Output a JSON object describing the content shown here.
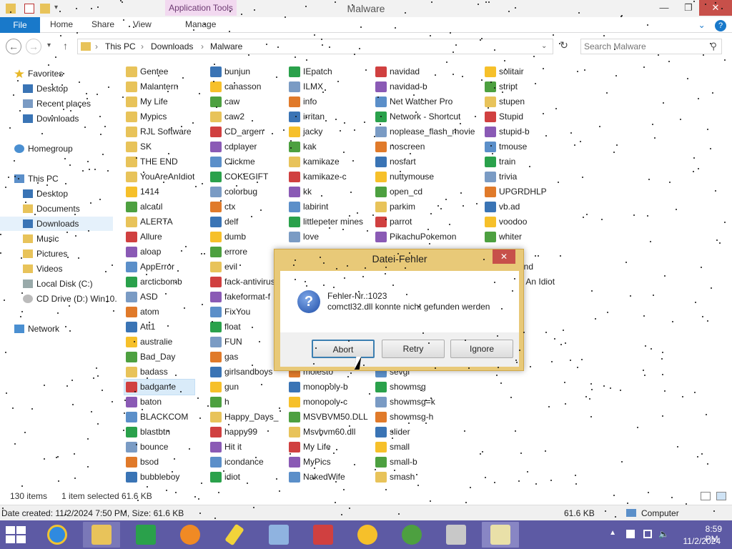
{
  "window": {
    "title": "Malware",
    "context_tab": "Application Tools",
    "minimize": "—",
    "maximize": "❐",
    "close": "✕"
  },
  "ribbon": {
    "file": "File",
    "home": "Home",
    "share": "Share",
    "view": "View",
    "manage": "Manage",
    "help": "?"
  },
  "address": {
    "back": "←",
    "forward": "→",
    "up": "↑",
    "crumbs": [
      "This PC",
      "Downloads",
      "Malware"
    ],
    "refresh": "↻",
    "search_placeholder": "Search Malware"
  },
  "nav": {
    "favorites": "Favorites",
    "desktop1": "Desktop",
    "recent": "Recent places",
    "downloads1": "Downloads",
    "homegroup": "Homegroup",
    "thispc": "This PC",
    "desktop2": "Desktop",
    "documents": "Documents",
    "downloads2": "Downloads",
    "music": "Music",
    "pictures": "Pictures",
    "videos": "Videos",
    "localdisk": "Local Disk (C:)",
    "cddrive": "CD Drive (D:) Win10.",
    "network": "Network"
  },
  "files": {
    "col1": [
      "Gentee",
      "Malantern",
      "My Life",
      "Mypics",
      "RJL Software",
      "SK",
      "THE END",
      "YouAreAnIdiot",
      "1414",
      "alcaul",
      "ALERTA",
      "Allure",
      "aloap",
      "AppError",
      "arcticbomb",
      "ASD",
      "atom",
      "Att1",
      "australie",
      "Bad_Day",
      "badass",
      "badgame",
      "baton",
      "BLACKCOM",
      "blastbtn",
      "bounce",
      "bsod",
      "bubbleboy"
    ],
    "col2": [
      "bunjun",
      "canasson",
      "caw",
      "caw2",
      "CD_argen",
      "cdplayer",
      "Clickme",
      "COKEGIFT",
      "colorbug",
      "ctx",
      "delf",
      "dumb",
      "errore",
      "evil",
      "fack-antivirus",
      "fakeformat-f",
      "FixYou",
      "float",
      "FUN",
      "gas",
      "girlsandboys",
      "gun",
      "h",
      "Happy_Days_",
      "happy99",
      "Hit it",
      "icondance",
      "idiot"
    ],
    "col3": [
      "IEpatch",
      "ILMX",
      "info",
      "irritan",
      "jacky",
      "kak",
      "kamikaze",
      "kamikaze-c",
      "kk",
      "labirint",
      "littlepeter mines",
      "love",
      "molesto",
      "monopoly-b",
      "monopoly-c",
      "MSVBVM50.DLL",
      "Msvbvm60.dll",
      "My Life",
      "MyPics",
      "NakedWife"
    ],
    "col4": [
      "navidad",
      "navidad-b",
      "Net Watcher Pro",
      "Network - Shortcut",
      "noplease_flash_movie",
      "noscreen",
      "nosfart",
      "nuttymouse",
      "open_cd",
      "parkim",
      "parrot",
      "PikachuPokemon",
      "sevgi",
      "showmsg",
      "showmsg=k",
      "showmsg-h",
      "slider",
      "small",
      "small-b",
      "smash"
    ],
    "col5": [
      "solitair",
      "stript",
      "stupen",
      "Stupid",
      "stupid-b",
      "tmouse",
      "train",
      "trivia",
      "UPGRDHLP",
      "vb.ad",
      "voodoo",
      "whiter",
      "und",
      "e An Idiot"
    ]
  },
  "status": {
    "count": "130 items",
    "selected": "1 item selected  61.6 KB",
    "date_created": "Date created: 11/2/2024 7:50 PM, Size: 61.6 KB",
    "size": "61.6 KB",
    "computer": "Computer"
  },
  "dialog": {
    "title": "Datei-Fehler",
    "close": "✕",
    "line1": "Fehler-Nr.:1023",
    "line2": "comctl32.dll konnte nicht gefunden werden",
    "icon": "?",
    "abort": "Abort",
    "retry": "Retry",
    "ignore": "Ignore"
  },
  "taskbar": {
    "time": "8:59 PM",
    "date": "11/2/2024"
  },
  "colors": {
    "accent": "#1979ca",
    "taskbar": "#5d5aa4",
    "dialog_frame": "#e8c978",
    "context_tab": "#f2d9f0",
    "close_red": "#c7504a"
  }
}
